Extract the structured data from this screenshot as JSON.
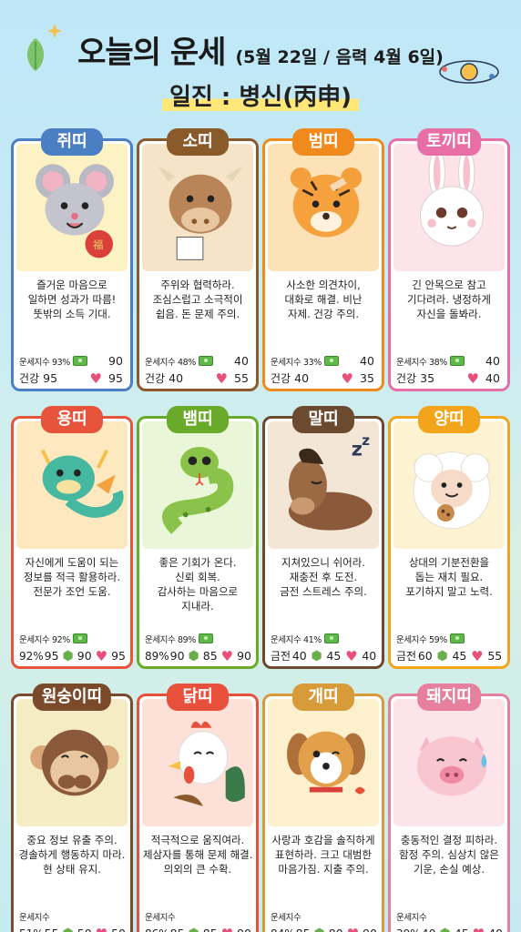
{
  "header": {
    "title": "오늘의 운세",
    "date": "(5월 22일 / 음력 4월 6일)",
    "ilji": "일진 : 병신(丙申)"
  },
  "colors": {
    "rat": "#4a7fc4",
    "ox": "#8b5a2b",
    "tiger": "#f08a1c",
    "rabbit": "#e76fa6",
    "dragon": "#e8533c",
    "snake": "#6aaa2a",
    "horse": "#6b4a30",
    "sheep": "#f2a51a",
    "monkey": "#7a4a2a",
    "rooster": "#e8503c",
    "dog": "#d89b3a",
    "pig": "#e7809e"
  },
  "cards": [
    {
      "name": "쥐띠",
      "icon": "mouse-icon",
      "lines": [
        "즐거운 마음으로",
        "일하면 성과가 따름!",
        "뚯밖의 소득 기대."
      ],
      "r1_label": "운세지수 93%",
      "r1_icon": "money-icon",
      "r1_val": "90",
      "r2_label": "건강",
      "r2_v1": "95",
      "r2_icon": "heart-icon",
      "r2_v2": "95"
    },
    {
      "name": "소띠",
      "icon": "ox-icon",
      "lines": [
        "주위와 협력하라.",
        "조심스럽고 소극적이",
        "쉽음. 돈 문제 주의."
      ],
      "r1_label": "운세지수 48%",
      "r1_icon": "money-icon",
      "r1_val": "40",
      "r2_label": "건강",
      "r2_v1": "40",
      "r2_icon": "heart-icon",
      "r2_v2": "55"
    },
    {
      "name": "범띠",
      "icon": "tiger-icon",
      "lines": [
        "사소한 의견차이,",
        "대화로 해결. 비난",
        "자제. 건강 주의."
      ],
      "r1_label": "운세지수 33%",
      "r1_icon": "money-icon",
      "r1_val": "40",
      "r2_label": "건강",
      "r2_v1": "40",
      "r2_icon": "heart-icon",
      "r2_v2": "35"
    },
    {
      "name": "토끼띠",
      "icon": "rabbit-icon",
      "lines": [
        "긴 안목으로 참고",
        "기다려라. 냉정하게",
        "자신을 돌봐라."
      ],
      "r1_label": "운세지수 38%",
      "r1_icon": "money-icon",
      "r1_val": "40",
      "r2_label": "건강",
      "r2_v1": "35",
      "r2_icon": "heart-icon",
      "r2_v2": "40"
    },
    {
      "name": "용띠",
      "icon": "dragon-icon",
      "lines": [
        "자신에게 도움이 되는",
        "정보를 적극 활용하라.",
        "전문가 조언 도움."
      ],
      "r1_label": "운세지수 92%",
      "r1_icon": "money-icon",
      "r1_val": "",
      "r2_label": "92%",
      "r2_v1": "95",
      "r2_icon": "shield-icon",
      "r2_v2": "90",
      "r2_icon2": "heart-icon",
      "r2_v3": "95"
    },
    {
      "name": "뱀띠",
      "icon": "snake-icon",
      "lines": [
        "좋은 기회가 온다.",
        "신뢰 회복.",
        "감사하는 마음으로",
        "지내라."
      ],
      "r1_label": "운세지수 89%",
      "r1_icon": "money-icon",
      "r1_val": "",
      "r2_label": "89%",
      "r2_v1": "90",
      "r2_icon": "shield-icon",
      "r2_v2": "85",
      "r2_icon2": "heart-icon",
      "r2_v3": "90"
    },
    {
      "name": "말띠",
      "icon": "horse-icon",
      "lines": [
        "지쳐있으니 쉬어라.",
        "재충전 후 도전.",
        "금전 스트레스 주의."
      ],
      "r1_label": "운세지수 41%",
      "r1_icon": "money-icon",
      "r1_val": "",
      "r2_label": "금전",
      "r2_v1": "40",
      "r2_icon": "shield-icon",
      "r2_v2": "45",
      "r2_icon2": "heart-icon",
      "r2_v3": "40"
    },
    {
      "name": "양띠",
      "icon": "sheep-icon",
      "lines": [
        "상대의 기분전환을",
        "돕는 재치 필요.",
        "포기하지 말고 노력."
      ],
      "r1_label": "운세지수 59%",
      "r1_icon": "money-icon",
      "r1_val": "",
      "r2_label": "금전",
      "r2_v1": "60",
      "r2_icon": "shield-icon",
      "r2_v2": "45",
      "r2_icon2": "heart-icon",
      "r2_v3": "55"
    },
    {
      "name": "원숭이띠",
      "icon": "monkey-icon",
      "lines": [
        "중요 정보 유출 주의.",
        "경솔하게 행동하지 마라.",
        "현 상태 유지."
      ],
      "r1_label": "운세지수",
      "r1_icon": "",
      "r1_val": "",
      "r2_label": "51%",
      "r2_v1": "55",
      "r2_icon": "shield-icon",
      "r2_v2": "50",
      "r2_icon2": "heart-icon",
      "r2_v3": "50"
    },
    {
      "name": "닭띠",
      "icon": "rooster-icon",
      "lines": [
        "적극적으로 움직여라.",
        "제삼자를 통해 문제 해결.",
        "의외의 큰 수확."
      ],
      "r1_label": "운세지수",
      "r1_icon": "",
      "r1_val": "",
      "r2_label": "86%",
      "r2_v1": "85",
      "r2_icon": "shield-icon",
      "r2_v2": "85",
      "r2_icon2": "heart-icon",
      "r2_v3": "90"
    },
    {
      "name": "개띠",
      "icon": "dog-icon",
      "lines": [
        "사랑과 호감을 솔직하게",
        "표현하라. 크고 대범한",
        "마음가짐. 지출 주의."
      ],
      "r1_label": "운세지수",
      "r1_icon": "",
      "r1_val": "",
      "r2_label": "84%",
      "r2_v1": "85",
      "r2_icon": "shield-icon",
      "r2_v2": "80",
      "r2_icon2": "heart-icon",
      "r2_v3": "90"
    },
    {
      "name": "돼지띠",
      "icon": "pig-icon",
      "lines": [
        "충동적인 결정 피하라.",
        "함정 주의. 심상치 않은",
        "기운, 손실 예상."
      ],
      "r1_label": "운세지수",
      "r1_icon": "",
      "r1_val": "",
      "r2_label": "39%",
      "r2_v1": "40",
      "r2_icon": "shield-icon",
      "r2_v2": "45",
      "r2_icon2": "heart-icon",
      "r2_v3": "40"
    }
  ]
}
